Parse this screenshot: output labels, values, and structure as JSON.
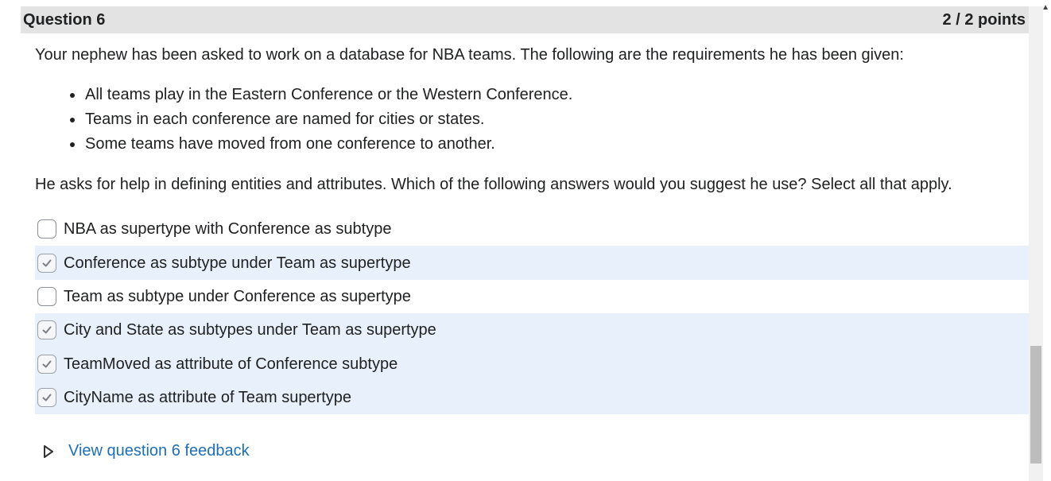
{
  "question": {
    "title": "Question 6",
    "points": "2 / 2 points",
    "prompt": "Your nephew has been asked to work on a database for NBA teams. The following are the requirements he has been given:",
    "requirements": [
      "All teams play in the Eastern Conference or the Western Conference.",
      "Teams in each conference are named for cities or states.",
      "Some teams have moved from one conference to another."
    ],
    "ask": "He asks for help in defining entities and attributes. Which of the following answers would you suggest he use? Select all that apply.",
    "options": [
      {
        "label": "NBA as supertype with Conference as subtype",
        "checked": false
      },
      {
        "label": "Conference as subtype under Team as supertype",
        "checked": true
      },
      {
        "label": "Team as subtype under Conference as supertype",
        "checked": false
      },
      {
        "label": "City and State as subtypes under Team as supertype",
        "checked": true
      },
      {
        "label": "TeamMoved as attribute of Conference subtype",
        "checked": true
      },
      {
        "label": "CityName as attribute of Team supertype",
        "checked": true
      }
    ],
    "feedback_link": "View question 6 feedback"
  },
  "colors": {
    "header_bg": "#e3e3e3",
    "selected_row_bg": "#e8f1fb",
    "link": "#1d6fb8"
  },
  "icons": {
    "collapse": "caret-up-icon",
    "checkmark": "check-icon",
    "feedback_toggle": "triangle-right-icon"
  }
}
